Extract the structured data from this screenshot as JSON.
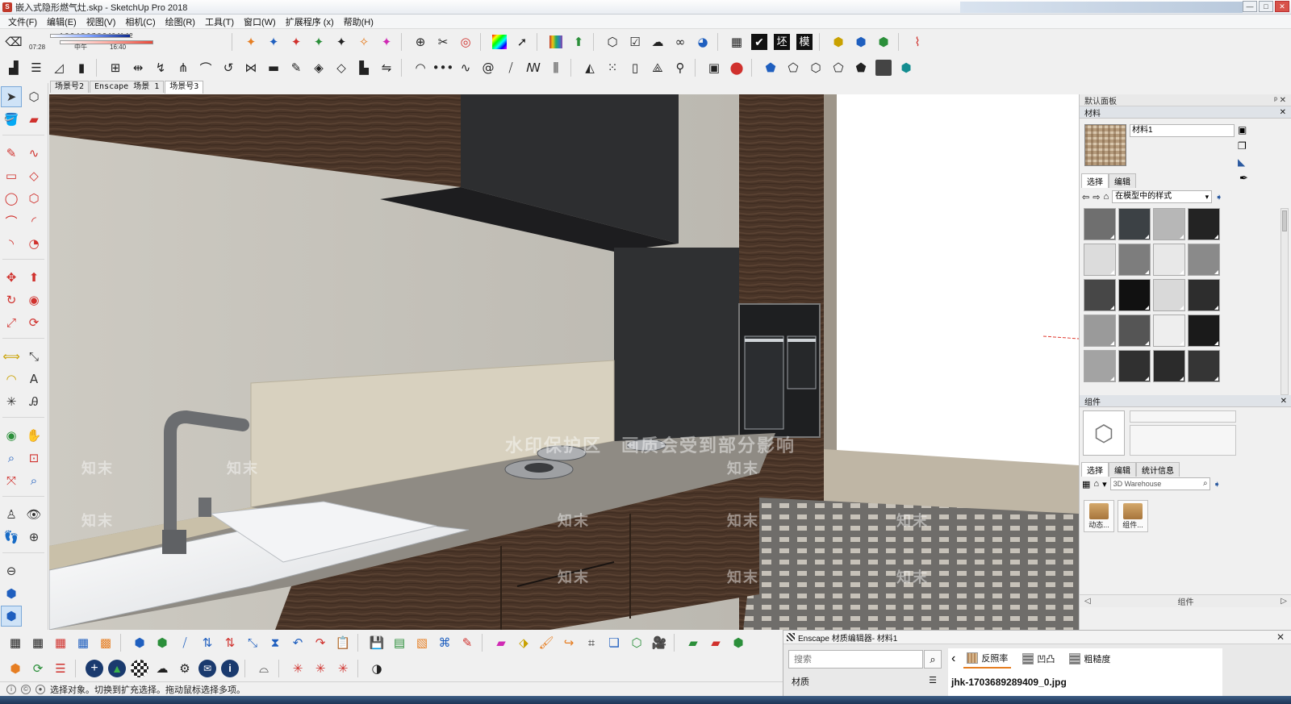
{
  "window": {
    "title": "嵌入式隐形燃气灶.skp - SketchUp Pro 2018"
  },
  "menu": [
    "文件(F)",
    "编辑(E)",
    "视图(V)",
    "相机(C)",
    "绘图(R)",
    "工具(T)",
    "窗口(W)",
    "扩展程序 (x)",
    "帮助(H)"
  ],
  "shadow": {
    "months": "1 2 3 4 5 6 7 8 9 10 11 12",
    "time_start": "07:28",
    "time_mid": "中午",
    "time_end": "16:40"
  },
  "toolbar_top": {
    "icons": [
      "eraser-icon",
      "axes-orange-icon",
      "axes-blue-icon",
      "axes-red-icon",
      "axes-green-icon",
      "axes-dark-icon",
      "axes-orange2-icon",
      "axes-magenta-icon",
      "crosshair-icon",
      "knife-icon",
      "target-icon",
      "color-grid-icon",
      "cursor-star-icon",
      "palette-icon",
      "arrow-up-icon",
      "box-icon",
      "checkbox-icon",
      "cloud-up-icon",
      "link-icon",
      "sphere-icon",
      "table-icon",
      "check-black-icon",
      "char-icon-1",
      "char-icon-2",
      "cube-yellow-icon",
      "cube-blue-icon",
      "cube-green-icon",
      "polyline-icon"
    ],
    "char1": "坯",
    "char2": "模"
  },
  "scene_tabs": [
    "场景号2",
    "Enscape 场景 1",
    "场景号3"
  ],
  "active_scene": "场景号3",
  "watermark": "水印保护区　画质会受到部分影响",
  "watermark_small": "知末",
  "right_panel": {
    "header": "默认面板",
    "materials": {
      "title": "材料",
      "name_value": "材料1",
      "tabs": [
        "选择",
        "编辑"
      ],
      "collection": "在模型中的样式",
      "swatch_colors": [
        "#6f6f6f",
        "#3c4145",
        "#b7b7b7",
        "#232323",
        "#dcdcdc",
        "#7d7d7d",
        "#e8e8e8",
        "#8a8a8a",
        "#474747",
        "#111111",
        "#d9d9d9",
        "#2d2d2d",
        "#9a9a9a",
        "#555555",
        "#eeeeee",
        "#1a1a1a",
        "#a3a3a3",
        "#303030",
        "#2b2b2b",
        "#353535"
      ]
    },
    "components": {
      "title": "组件",
      "tabs": [
        "选择",
        "编辑",
        "统计信息"
      ],
      "search_placeholder": "3D Warehouse",
      "items": [
        "动态...",
        "组件..."
      ],
      "footer": "组件"
    }
  },
  "enscape": {
    "title": "Enscape 材质编辑器- 材料1",
    "search_placeholder": "搜索",
    "materials_label": "材质",
    "tabs": [
      "反照率",
      "凹凸",
      "粗糙度"
    ],
    "file": "jhk-1703689289409_0.jpg"
  },
  "status": {
    "text": "选择对象。切换到扩充选择。拖动鼠标选择多项。"
  },
  "colors": {
    "cabinet_wood": "#4a3528",
    "countertop": "#8f8b84",
    "backsplash": "#c8c5bd",
    "accent_orange": "#e67e22"
  }
}
